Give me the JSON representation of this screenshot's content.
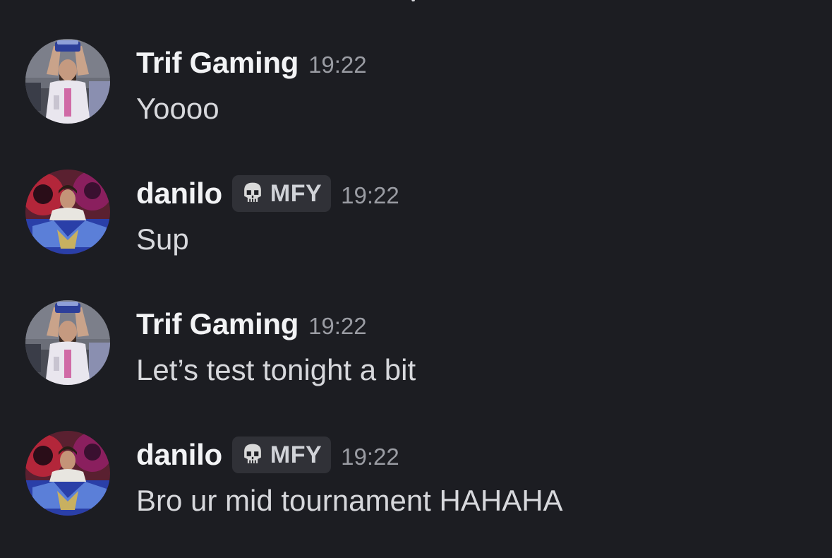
{
  "messages": [
    {
      "author": "Trif Gaming",
      "timestamp": "19:22",
      "text": "Yoooo",
      "avatar": "trif-avatar"
    },
    {
      "author": "danilo",
      "tag": {
        "icon": "skull-icon",
        "label": "MFY"
      },
      "timestamp": "19:22",
      "text": "Sup",
      "avatar": "danilo-avatar"
    },
    {
      "author": "Trif Gaming",
      "timestamp": "19:22",
      "text": "Let’s test tonight a bit",
      "avatar": "trif-avatar"
    },
    {
      "author": "danilo",
      "tag": {
        "icon": "skull-icon",
        "label": "MFY"
      },
      "timestamp": "19:22",
      "text": "Bro ur mid tournament HAHAHA",
      "avatar": "danilo-avatar"
    }
  ],
  "colors": {
    "background": "#1c1d22",
    "username": "#f2f3f5",
    "timestamp": "#9a9ca3",
    "message_text": "#d7d8dc",
    "tag_background": "#303137"
  }
}
